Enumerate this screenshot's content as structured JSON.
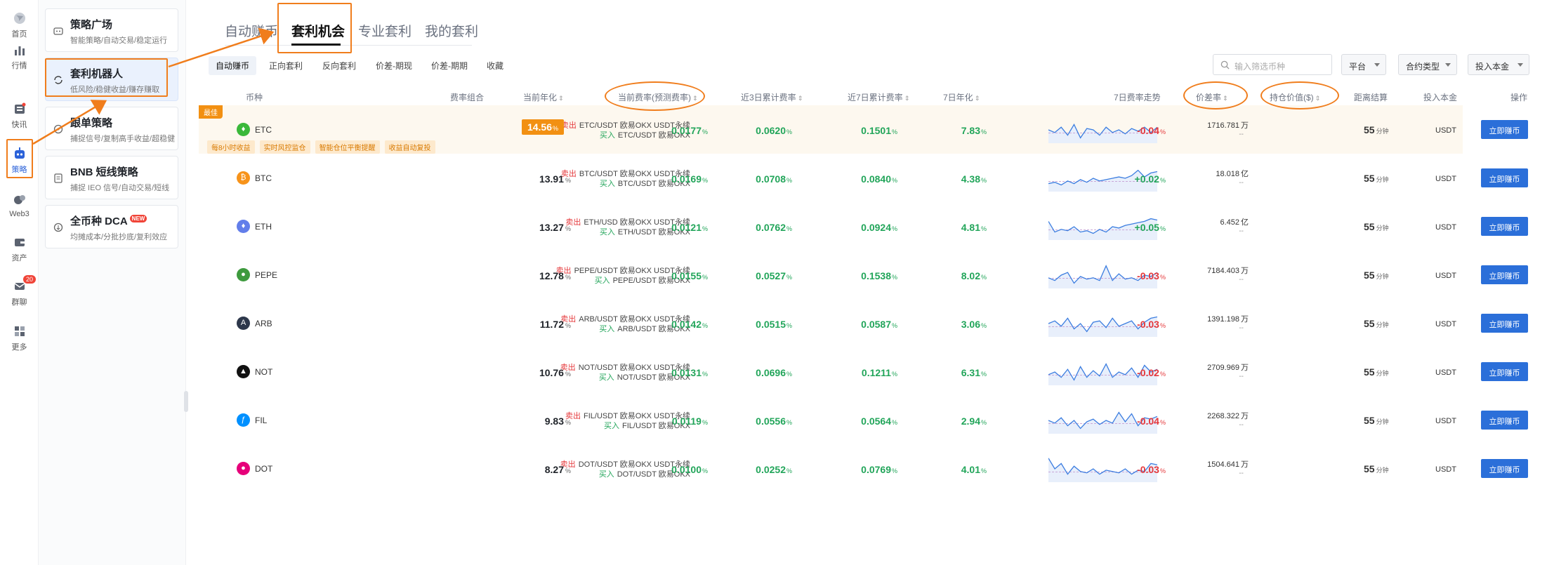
{
  "rail": [
    {
      "label": "首页",
      "icon": "globe-icon"
    },
    {
      "label": "行情",
      "icon": "bar-chart-icon"
    },
    {
      "label": "快讯",
      "icon": "news-icon"
    },
    {
      "label": "策略",
      "icon": "robot-icon"
    },
    {
      "label": "Web3",
      "icon": "web3-icon"
    },
    {
      "label": "资产",
      "icon": "wallet-icon"
    },
    {
      "label": "群聊",
      "icon": "chat-icon",
      "badge": "20"
    },
    {
      "label": "更多",
      "icon": "grid-icon"
    }
  ],
  "strategies": [
    {
      "title": "策略广场",
      "subtitle": "智能策略/自动交易/稳定运行"
    },
    {
      "title": "套利机器人",
      "subtitle": "低风险/稳健收益/赚存赚取"
    },
    {
      "title": "跟单策略",
      "subtitle": "捕捉信号/复制高手收益/超稳健"
    },
    {
      "title": "BNB 短线策略",
      "subtitle": "捕捉 IEO 信号/自动交易/短线"
    },
    {
      "title": "全币种 DCA",
      "subtitle": "均摊成本/分批抄底/复利效应",
      "badge": "NEW"
    }
  ],
  "top_tabs": [
    "自动赚币",
    "套利机会",
    "专业套利",
    "我的套利"
  ],
  "sub_tabs": [
    "自动赚币",
    "正向套利",
    "反向套利",
    "价差-期现",
    "价差-期期",
    "收藏"
  ],
  "filters": {
    "search_placeholder": "输入筛选币种",
    "platform": "平台",
    "contract_type": "合约类型",
    "invest": "投入本金"
  },
  "columns": {
    "coin": "币种",
    "combo": "费率组合",
    "annual": "当前年化",
    "current_rate": "当前费率(预测费率)",
    "rate3d": "近3日累计费率",
    "rate7d": "近7日累计费率",
    "annual7d": "7日年化",
    "trend": "7日费率走势",
    "spread": "价差率",
    "oi": "持仓价值($)",
    "settle": "距离结算",
    "invest": "投入本金",
    "action": "操作"
  },
  "labels": {
    "sell": "卖出",
    "buy": "买入",
    "best": "最佳",
    "pct": "%",
    "minute": "分钟",
    "action_btn": "立即赚币",
    "dash": "--"
  },
  "feature_tags": [
    "每8小时收益",
    "实时风控监仓",
    "智能仓位平衡提醒",
    "收益自动复投"
  ],
  "rows": [
    {
      "coin": "ETC",
      "sell": "ETC/USDT 欧易OKX USDT永续",
      "buy": "ETC/USDT 欧易OKX",
      "annual": "14.56",
      "rate": "0.0177",
      "r3": "0.0620",
      "r7": "0.1501",
      "a7": "7.83",
      "spread": "-0.04",
      "oi": "1716.781",
      "oi_unit": "万",
      "settle": "55",
      "invest": "USDT",
      "trend": [
        0.5,
        0.4,
        0.6,
        0.3,
        0.7,
        0.2,
        0.55,
        0.5,
        0.3,
        0.6,
        0.4,
        0.5,
        0.35,
        0.55,
        0.45,
        0.6,
        0.4,
        0.6
      ]
    },
    {
      "coin": "BTC",
      "sell": "BTC/USDT 欧易OKX USDT永续",
      "buy": "BTC/USDT 欧易OKX",
      "annual": "13.91",
      "rate": "0.0169",
      "r3": "0.0708",
      "r7": "0.0840",
      "a7": "4.38",
      "spread": "+0.02",
      "oi": "18.018",
      "oi_unit": "亿",
      "settle": "55",
      "invest": "USDT",
      "trend": [
        0.3,
        0.35,
        0.25,
        0.4,
        0.3,
        0.45,
        0.35,
        0.5,
        0.4,
        0.45,
        0.5,
        0.55,
        0.5,
        0.6,
        0.8,
        0.55,
        0.7,
        0.75
      ]
    },
    {
      "coin": "ETH",
      "sell": "ETH/USD 欧易OKX USDT永续",
      "buy": "ETH/USDT 欧易OKX",
      "annual": "13.27",
      "rate": "0.0121",
      "r3": "0.0762",
      "r7": "0.0924",
      "a7": "4.81",
      "spread": "+0.05",
      "oi": "6.452",
      "oi_unit": "亿",
      "settle": "55",
      "invest": "USDT",
      "trend": [
        0.7,
        0.3,
        0.4,
        0.35,
        0.5,
        0.3,
        0.35,
        0.25,
        0.4,
        0.3,
        0.5,
        0.45,
        0.55,
        0.6,
        0.65,
        0.7,
        0.8,
        0.75
      ]
    },
    {
      "coin": "PEPE",
      "sell": "PEPE/USDT 欧易OKX USDT永续",
      "buy": "PEPE/USDT 欧易OKX",
      "annual": "12.78",
      "rate": "0.0155",
      "r3": "0.0527",
      "r7": "0.1538",
      "a7": "8.02",
      "spread": "-0.03",
      "oi": "7184.403",
      "oi_unit": "万",
      "settle": "55",
      "invest": "USDT",
      "trend": [
        0.4,
        0.3,
        0.5,
        0.6,
        0.2,
        0.45,
        0.35,
        0.4,
        0.3,
        0.85,
        0.3,
        0.55,
        0.35,
        0.4,
        0.3,
        0.5,
        0.45,
        0.6
      ]
    },
    {
      "coin": "ARB",
      "sell": "ARB/USDT 欧易OKX USDT永续",
      "buy": "ARB/USDT 欧易OKX",
      "annual": "11.72",
      "rate": "0.0142",
      "r3": "0.0515",
      "r7": "0.0587",
      "a7": "3.06",
      "spread": "-0.03",
      "oi": "1391.198",
      "oi_unit": "万",
      "settle": "55",
      "invest": "USDT",
      "trend": [
        0.5,
        0.6,
        0.4,
        0.7,
        0.3,
        0.5,
        0.2,
        0.55,
        0.6,
        0.35,
        0.7,
        0.4,
        0.5,
        0.6,
        0.3,
        0.55,
        0.7,
        0.75
      ]
    },
    {
      "coin": "NOT",
      "sell": "NOT/USDT 欧易OKX USDT永续",
      "buy": "NOT/USDT 欧易OKX",
      "annual": "10.76",
      "rate": "0.0131",
      "r3": "0.0696",
      "r7": "0.1211",
      "a7": "6.31",
      "spread": "-0.02",
      "oi": "2709.969",
      "oi_unit": "万",
      "settle": "55",
      "invest": "USDT",
      "trend": [
        0.4,
        0.5,
        0.3,
        0.6,
        0.2,
        0.7,
        0.3,
        0.55,
        0.35,
        0.8,
        0.3,
        0.5,
        0.4,
        0.65,
        0.3,
        0.75,
        0.5,
        0.6
      ]
    },
    {
      "coin": "FIL",
      "sell": "FIL/USDT 欧易OKX USDT永续",
      "buy": "FIL/USDT 欧易OKX",
      "annual": "9.83",
      "rate": "0.0119",
      "r3": "0.0556",
      "r7": "0.0564",
      "a7": "2.94",
      "spread": "-0.04",
      "oi": "2268.322",
      "oi_unit": "万",
      "settle": "55",
      "invest": "USDT",
      "trend": [
        0.5,
        0.4,
        0.6,
        0.3,
        0.5,
        0.2,
        0.45,
        0.55,
        0.35,
        0.5,
        0.4,
        0.8,
        0.45,
        0.75,
        0.3,
        0.6,
        0.55,
        0.65
      ]
    },
    {
      "coin": "DOT",
      "sell": "DOT/USDT 欧易OKX USDT永续",
      "buy": "DOT/USDT 欧易OKX",
      "annual": "8.27",
      "rate": "0.0100",
      "r3": "0.0252",
      "r7": "0.0769",
      "a7": "4.01",
      "spread": "-0.03",
      "oi": "1504.641",
      "oi_unit": "万",
      "settle": "55",
      "invest": "USDT",
      "trend": [
        0.9,
        0.5,
        0.7,
        0.3,
        0.6,
        0.4,
        0.35,
        0.5,
        0.3,
        0.45,
        0.4,
        0.35,
        0.5,
        0.3,
        0.45,
        0.4,
        0.7,
        0.65
      ]
    }
  ],
  "coin_colors": {
    "ETC": "#3ab83a",
    "BTC": "#f7931a",
    "ETH": "#627eea",
    "PEPE": "#3d9a3d",
    "ARB": "#2d374b",
    "NOT": "#111111",
    "FIL": "#0090ff",
    "DOT": "#e6007a"
  },
  "accent": "#2b6fd9",
  "annotation_color": "#f07d1c"
}
